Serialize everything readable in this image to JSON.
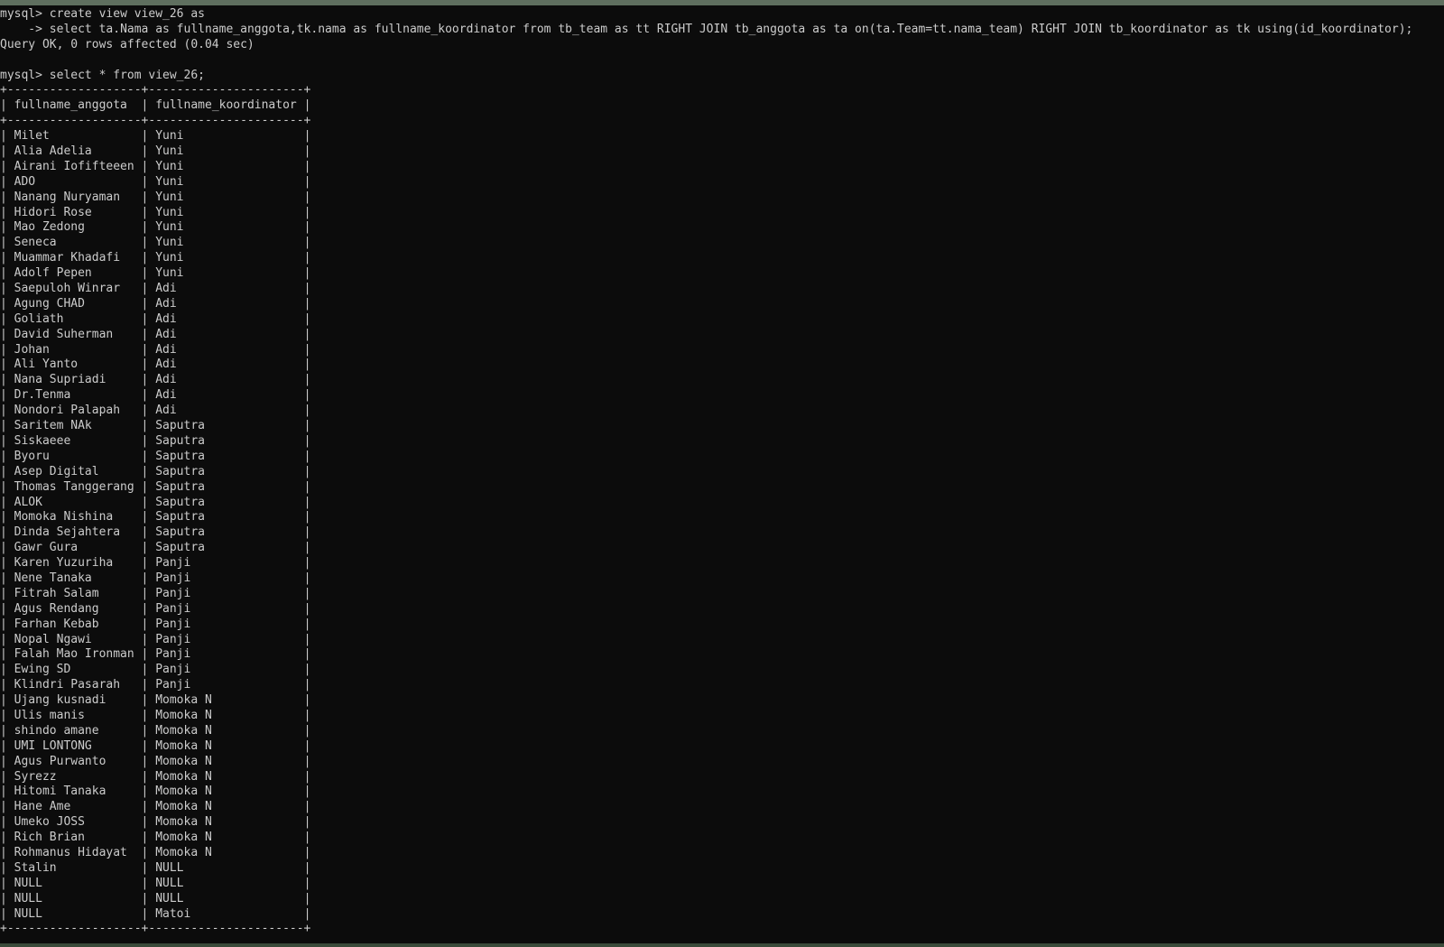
{
  "console": {
    "prompt": "mysql> ",
    "continuation": "    -> ",
    "command1": "create view view_26 as",
    "command1_cont": "select ta.Nama as fullname_anggota,tk.nama as fullname_koordinator from tb_team as tt RIGHT JOIN tb_anggota as ta on(ta.Team=tt.nama_team) RIGHT JOIN tb_koordinator as tk using(id_koordinator);",
    "result1": "Query OK, 0 rows affected (0.04 sec)",
    "command2": "select * from view_26;"
  },
  "table": {
    "columns": [
      "fullname_anggota",
      "fullname_koordinator"
    ],
    "rows": [
      [
        "Milet",
        "Yuni"
      ],
      [
        "Alia Adelia",
        "Yuni"
      ],
      [
        "Airani Iofifteeen",
        "Yuni"
      ],
      [
        "ADO",
        "Yuni"
      ],
      [
        "Nanang Nuryaman",
        "Yuni"
      ],
      [
        "Hidori Rose",
        "Yuni"
      ],
      [
        "Mao Zedong",
        "Yuni"
      ],
      [
        "Seneca",
        "Yuni"
      ],
      [
        "Muammar Khadafi",
        "Yuni"
      ],
      [
        "Adolf Pepen",
        "Yuni"
      ],
      [
        "Saepuloh Winrar",
        "Adi"
      ],
      [
        "Agung CHAD",
        "Adi"
      ],
      [
        "Goliath",
        "Adi"
      ],
      [
        "David Suherman",
        "Adi"
      ],
      [
        "Johan",
        "Adi"
      ],
      [
        "Ali Yanto",
        "Adi"
      ],
      [
        "Nana Supriadi",
        "Adi"
      ],
      [
        "Dr.Tenma",
        "Adi"
      ],
      [
        "Nondori Palapah",
        "Adi"
      ],
      [
        "Saritem NAk",
        "Saputra"
      ],
      [
        "Siskaeee",
        "Saputra"
      ],
      [
        "Byoru",
        "Saputra"
      ],
      [
        "Asep Digital",
        "Saputra"
      ],
      [
        "Thomas Tanggerang",
        "Saputra"
      ],
      [
        "ALOK",
        "Saputra"
      ],
      [
        "Momoka Nishina",
        "Saputra"
      ],
      [
        "Dinda Sejahtera",
        "Saputra"
      ],
      [
        "Gawr Gura",
        "Saputra"
      ],
      [
        "Karen Yuzuriha",
        "Panji"
      ],
      [
        "Nene Tanaka",
        "Panji"
      ],
      [
        "Fitrah Salam",
        "Panji"
      ],
      [
        "Agus Rendang",
        "Panji"
      ],
      [
        "Farhan Kebab",
        "Panji"
      ],
      [
        "Nopal Ngawi",
        "Panji"
      ],
      [
        "Falah Mao Ironman",
        "Panji"
      ],
      [
        "Ewing SD",
        "Panji"
      ],
      [
        "Klindri Pasarah",
        "Panji"
      ],
      [
        "Ujang kusnadi",
        "Momoka N"
      ],
      [
        "Ulis manis",
        "Momoka N"
      ],
      [
        "shindo amane",
        "Momoka N"
      ],
      [
        "UMI LONTONG",
        "Momoka N"
      ],
      [
        "Agus Purwanto",
        "Momoka N"
      ],
      [
        "Syrezz",
        "Momoka N"
      ],
      [
        "Hitomi Tanaka",
        "Momoka N"
      ],
      [
        "Hane Ame",
        "Momoka N"
      ],
      [
        "Umeko JOSS",
        "Momoka N"
      ],
      [
        "Rich Brian",
        "Momoka N"
      ],
      [
        "Rohmanus Hidayat",
        "Momoka N"
      ],
      [
        "Stalin",
        "NULL"
      ],
      [
        "NULL",
        "NULL"
      ],
      [
        "NULL",
        "NULL"
      ],
      [
        "NULL",
        "Matoi"
      ]
    ]
  },
  "colors": {
    "background": "#0c0c0c",
    "text": "#cccccc"
  }
}
